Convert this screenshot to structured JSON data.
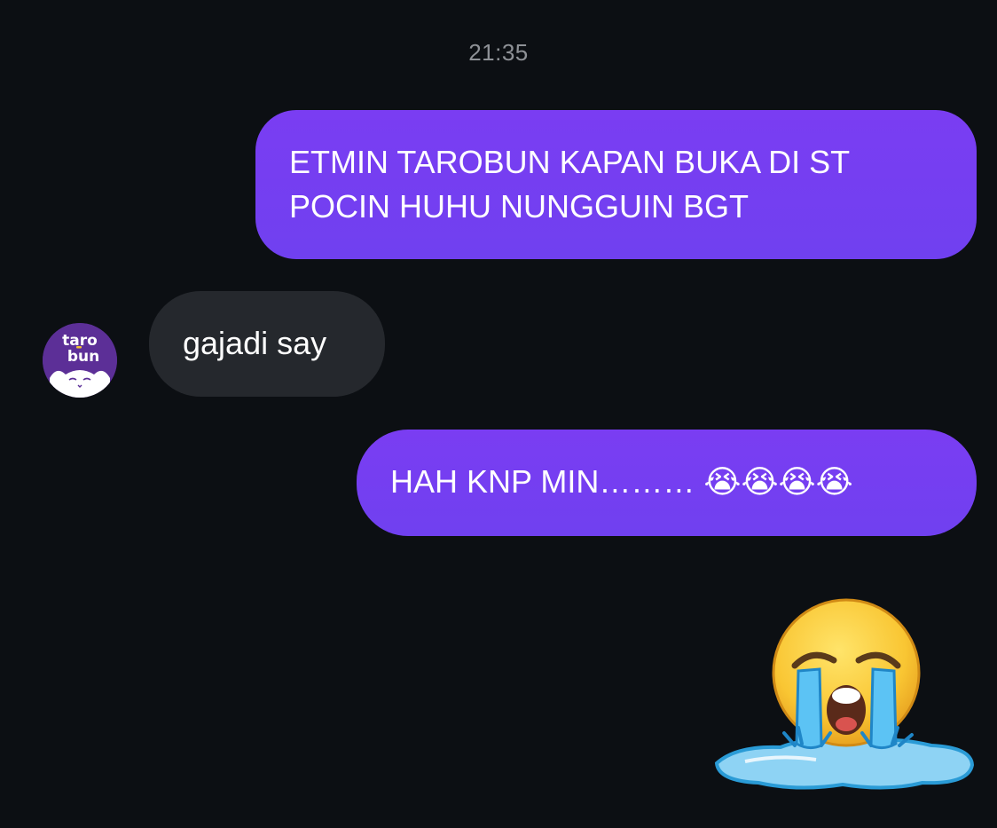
{
  "chat": {
    "timestamp": "21:35",
    "messages": [
      {
        "direction": "sent",
        "text": "ETMIN TAROBUN KAPAN BUKA DI ST POCIN HUHU NUNGGUIN BGT"
      },
      {
        "direction": "received",
        "text": "gajadi say"
      },
      {
        "direction": "sent",
        "text": "HAH KNP MIN……… 😭😭😭😭"
      }
    ],
    "avatar": {
      "brand": "tarobun",
      "line1": "taro",
      "line2": "bun"
    },
    "sticker": {
      "icon": "crying-face-sticker"
    }
  },
  "colors": {
    "background": "#0c0f13",
    "sent_bubble": "#7040f0",
    "received_bubble": "#25282d",
    "timestamp": "#8e9196",
    "avatar": "#5c2f97"
  }
}
